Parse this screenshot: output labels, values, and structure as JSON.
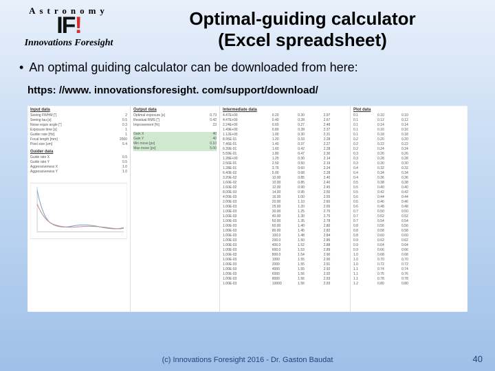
{
  "logo": {
    "arc": "Astronomy",
    "mark_left": "IF",
    "mark_right": "!",
    "sub": "Innovations Foresight"
  },
  "title_line1": "Optimal-guiding calculator",
  "title_line2": "(Excel spreadsheet)",
  "bullet": "An optimal guiding calculator can be downloaded from here:",
  "url": "https: //www. innovationsforesight. com/support/download/",
  "sheet": {
    "col1_hdr": "Input data",
    "col1": [
      [
        "Seeing FWHM [\"]",
        "2"
      ],
      [
        "Seeing tau [s]",
        "0.5"
      ],
      [
        "Noise equiv angle [\"]",
        "0.3"
      ],
      [
        "Exposure time [s]",
        "1"
      ],
      [
        "Guider rate [Hz]",
        "1"
      ],
      [
        "Focal length [mm]",
        "2000"
      ],
      [
        "Pixel size [um]",
        "5.4"
      ]
    ],
    "col1_hdr2": "Guider data",
    "col1b": [
      [
        "Guide rate X",
        "0.5"
      ],
      [
        "Guide rate Y",
        "0.5"
      ],
      [
        "Aggressiveness X",
        "1.0"
      ],
      [
        "Aggressiveness Y",
        "1.0"
      ]
    ],
    "col2_hdr": "Output data",
    "col2": [
      [
        "Optimal exposure [s]",
        "0.73"
      ],
      [
        "Residual RMS [\"]",
        "0.42"
      ],
      [
        "Improvement [%]",
        "23"
      ]
    ],
    "col2b": [
      [
        "Gain X",
        "40"
      ],
      [
        "Gain Y",
        "40"
      ],
      [
        "Min move [px]",
        "0.10"
      ],
      [
        "Max move [px]",
        "5.00"
      ]
    ],
    "col3_hdr": "Intermediate data",
    "col3": [
      [
        "4.47E+00",
        "0.20",
        "0.30",
        "2.97"
      ],
      [
        "4.47E+00",
        "0.40",
        "0.28",
        "2.67"
      ],
      [
        "2.24E+00",
        "0.60",
        "0.27",
        "2.48"
      ],
      [
        "1.49E+00",
        "0.80",
        "0.28",
        "2.37"
      ],
      [
        "1.12E+00",
        "1.00",
        "0.30",
        "2.31"
      ],
      [
        "8.95E-01",
        "1.20",
        "0.33",
        "2.28"
      ],
      [
        "7.46E-01",
        "1.40",
        "0.37",
        "2.27"
      ],
      [
        "6.39E-01",
        "1.60",
        "0.42",
        "2.28"
      ],
      [
        "5.59E-01",
        "1.80",
        "0.47",
        "2.30"
      ],
      [
        "1.28E+00",
        "1.25",
        "0.30",
        "2.14"
      ],
      [
        "2.56E-01",
        "2.50",
        "0.50",
        "2.19"
      ],
      [
        "1.28E-01",
        "3.75",
        "0.60",
        "2.24"
      ],
      [
        "6.40E-02",
        "5.00",
        "0.68",
        "2.28"
      ],
      [
        "3.20E-02",
        "10.00",
        "0.85",
        "2.40"
      ],
      [
        "1.60E-02",
        "10.00",
        "0.85",
        "2.40"
      ],
      [
        "1.60E-02",
        "12.00",
        "0.90",
        "2.45"
      ],
      [
        "8.00E-03",
        "14.00",
        "0.95",
        "2.50"
      ],
      [
        "4.00E-03",
        "16.00",
        "1.00",
        "2.55"
      ],
      [
        "2.00E-03",
        "20.00",
        "1.10",
        "2.60"
      ],
      [
        "1.00E-03",
        "25.00",
        "1.20",
        "2.65"
      ],
      [
        "1.00E-03",
        "30.00",
        "1.25",
        "2.70"
      ],
      [
        "1.00E-03",
        "40.00",
        "1.30",
        "2.75"
      ],
      [
        "1.00E-03",
        "50.00",
        "1.35",
        "2.78"
      ],
      [
        "1.00E-03",
        "60.00",
        "1.40",
        "2.80"
      ],
      [
        "1.00E-03",
        "80.00",
        "1.45",
        "2.82"
      ],
      [
        "1.00E-03",
        "100.0",
        "1.48",
        "2.84"
      ],
      [
        "1.00E-03",
        "200.0",
        "1.50",
        "2.86"
      ],
      [
        "1.00E-03",
        "400.0",
        "1.52",
        "2.88"
      ],
      [
        "1.00E-03",
        "600.0",
        "1.53",
        "2.89"
      ],
      [
        "1.00E-03",
        "800.0",
        "1.54",
        "2.90"
      ],
      [
        "1.00E-03",
        "1000",
        "1.55",
        "2.90"
      ],
      [
        "1.00E-03",
        "2000",
        "1.55",
        "2.91"
      ],
      [
        "1.00E-03",
        "4000",
        "1.55",
        "2.92"
      ],
      [
        "1.00E-03",
        "6000",
        "1.56",
        "2.92"
      ],
      [
        "1.00E-03",
        "8000",
        "1.56",
        "2.93"
      ],
      [
        "1.00E-03",
        "10000",
        "1.56",
        "2.93"
      ]
    ],
    "col4_hdr": "Plot data",
    "col4": [
      [
        "0.1",
        "0.10",
        "0.10"
      ],
      [
        "0.1",
        "0.12",
        "0.12"
      ],
      [
        "0.1",
        "0.14",
        "0.14"
      ],
      [
        "0.1",
        "0.16",
        "0.16"
      ],
      [
        "0.1",
        "0.18",
        "0.18"
      ],
      [
        "0.2",
        "0.20",
        "0.20"
      ],
      [
        "0.2",
        "0.22",
        "0.22"
      ],
      [
        "0.2",
        "0.24",
        "0.24"
      ],
      [
        "0.3",
        "0.26",
        "0.26"
      ],
      [
        "0.3",
        "0.28",
        "0.28"
      ],
      [
        "0.3",
        "0.30",
        "0.30"
      ],
      [
        "0.4",
        "0.32",
        "0.32"
      ],
      [
        "0.4",
        "0.34",
        "0.34"
      ],
      [
        "0.4",
        "0.36",
        "0.36"
      ],
      [
        "0.5",
        "0.38",
        "0.38"
      ],
      [
        "0.5",
        "0.40",
        "0.40"
      ],
      [
        "0.5",
        "0.42",
        "0.42"
      ],
      [
        "0.6",
        "0.44",
        "0.44"
      ],
      [
        "0.6",
        "0.46",
        "0.46"
      ],
      [
        "0.6",
        "0.48",
        "0.48"
      ],
      [
        "0.7",
        "0.50",
        "0.50"
      ],
      [
        "0.7",
        "0.52",
        "0.52"
      ],
      [
        "0.7",
        "0.54",
        "0.54"
      ],
      [
        "0.8",
        "0.56",
        "0.56"
      ],
      [
        "0.8",
        "0.58",
        "0.58"
      ],
      [
        "0.8",
        "0.60",
        "0.60"
      ],
      [
        "0.9",
        "0.62",
        "0.62"
      ],
      [
        "0.9",
        "0.64",
        "0.64"
      ],
      [
        "0.9",
        "0.66",
        "0.66"
      ],
      [
        "1.0",
        "0.68",
        "0.68"
      ],
      [
        "1.0",
        "0.70",
        "0.70"
      ],
      [
        "1.0",
        "0.72",
        "0.72"
      ],
      [
        "1.1",
        "0.74",
        "0.74"
      ],
      [
        "1.1",
        "0.76",
        "0.76"
      ],
      [
        "1.1",
        "0.78",
        "0.78"
      ],
      [
        "1.2",
        "0.80",
        "0.80"
      ]
    ]
  },
  "footer": "(c) Innovations Foresight 2016 - Dr. Gaston Baudat",
  "page": "40"
}
